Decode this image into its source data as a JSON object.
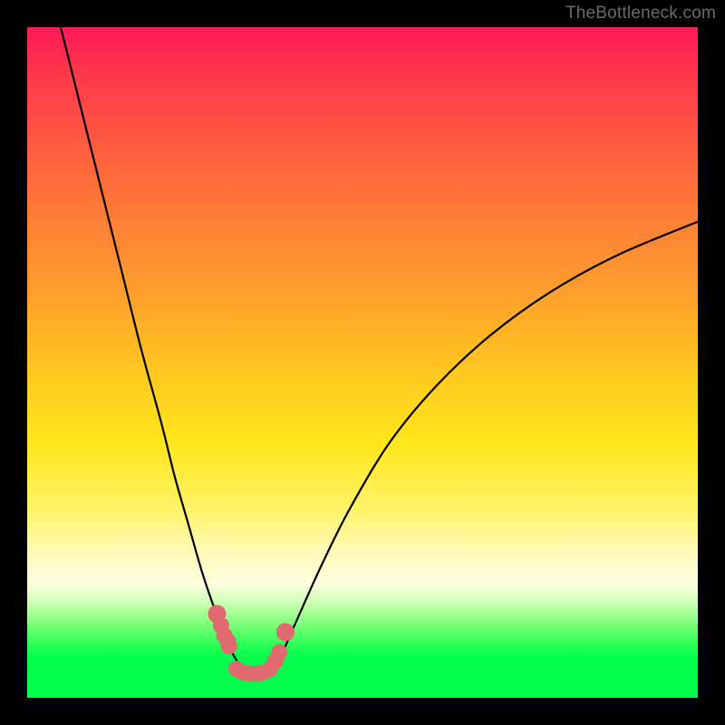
{
  "watermark": "TheBottleneck.com",
  "chart_data": {
    "type": "line",
    "title": "",
    "xlabel": "",
    "ylabel": "",
    "xlim": [
      0,
      100
    ],
    "ylim": [
      0,
      100
    ],
    "series": [
      {
        "name": "left-curve",
        "x": [
          5,
          8,
          11,
          14,
          17,
          20,
          22,
          24,
          26,
          27.5,
          29,
          30,
          30.8,
          31.6,
          32.3,
          33
        ],
        "y": [
          100,
          88,
          76,
          64,
          52,
          41,
          33,
          26,
          19,
          14.5,
          10.5,
          8,
          6.3,
          5,
          4.2,
          3.8
        ]
      },
      {
        "name": "right-curve",
        "x": [
          36.5,
          37.3,
          38.2,
          39.5,
          41.5,
          44,
          48,
          54,
          61,
          69,
          78,
          88,
          100
        ],
        "y": [
          3.8,
          5,
          7,
          10,
          14.5,
          20,
          28,
          38,
          46.5,
          54,
          60.5,
          66,
          71
        ]
      },
      {
        "name": "markers-left",
        "x": [
          28.3,
          28.9,
          29.4,
          29.9,
          30.1
        ],
        "y": [
          12.5,
          10.8,
          9.3,
          8.5,
          7.7
        ]
      },
      {
        "name": "markers-bottom",
        "x": [
          31.2,
          32.2,
          33.2,
          34.2,
          35.2,
          36.2
        ],
        "y": [
          4.3,
          3.8,
          3.6,
          3.6,
          3.8,
          4.3
        ]
      },
      {
        "name": "markers-right",
        "x": [
          37.0,
          37.6,
          38.5
        ],
        "y": [
          5.5,
          6.8,
          9.8
        ]
      }
    ],
    "marker_color": "#e06a6f",
    "line_color": "#000000"
  }
}
